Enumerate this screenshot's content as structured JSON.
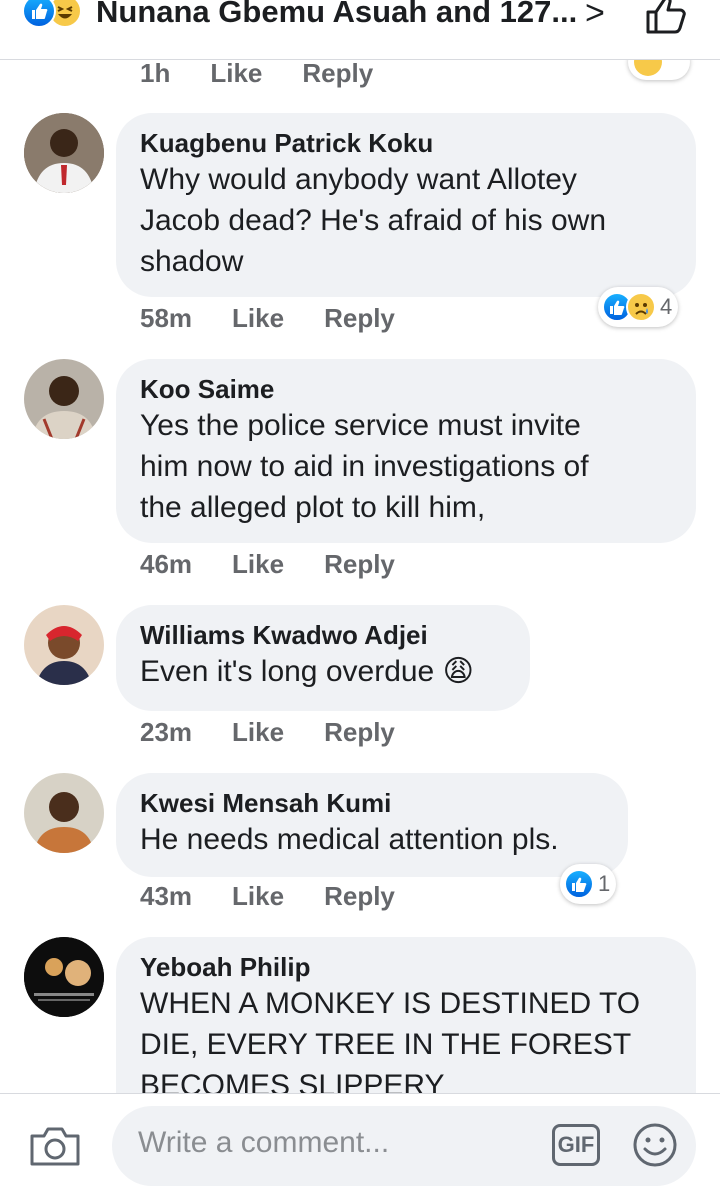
{
  "header": {
    "title": "Nunana Gbemu Asuah and 127...",
    "chevron": ">"
  },
  "prev_comment": {
    "time": "1h",
    "like_label": "Like",
    "reply_label": "Reply"
  },
  "comments": [
    {
      "name": "Kuagbenu Patrick Koku",
      "text_lines": [
        "Why would anybody want Allotey",
        "Jacob dead? He's afraid of his own",
        "shadow"
      ],
      "time": "58m",
      "like_label": "Like",
      "reply_label": "Reply",
      "reactions": {
        "icons": [
          "like-icon",
          "sad-icon"
        ],
        "count": "4"
      }
    },
    {
      "name": "Koo Saime",
      "text_lines": [
        "Yes the police service must invite",
        "him now to aid in investigations of",
        "the alleged plot to kill him,"
      ],
      "time": "46m",
      "like_label": "Like",
      "reply_label": "Reply"
    },
    {
      "name": "Williams Kwadwo Adjei",
      "text_lines": [
        "Even it's long overdue 😩"
      ],
      "time": "23m",
      "like_label": "Like",
      "reply_label": "Reply"
    },
    {
      "name": "Kwesi Mensah Kumi",
      "text_lines": [
        "He needs medical attention pls."
      ],
      "time": "43m",
      "like_label": "Like",
      "reply_label": "Reply",
      "reactions": {
        "icons": [
          "like-icon"
        ],
        "count": "1"
      }
    },
    {
      "name": "Yeboah Philip",
      "text_lines": [
        "WHEN A MONKEY IS DESTINED TO",
        "DIE, EVERY TREE IN THE FOREST",
        "BECOMES SLIPPERY"
      ]
    }
  ],
  "composer": {
    "placeholder": "Write a comment...",
    "gif_label": "GIF"
  },
  "colors": {
    "brand_blue": "#1877f2",
    "bubble_bg": "#f0f2f5",
    "meta_gray": "#65676b"
  }
}
